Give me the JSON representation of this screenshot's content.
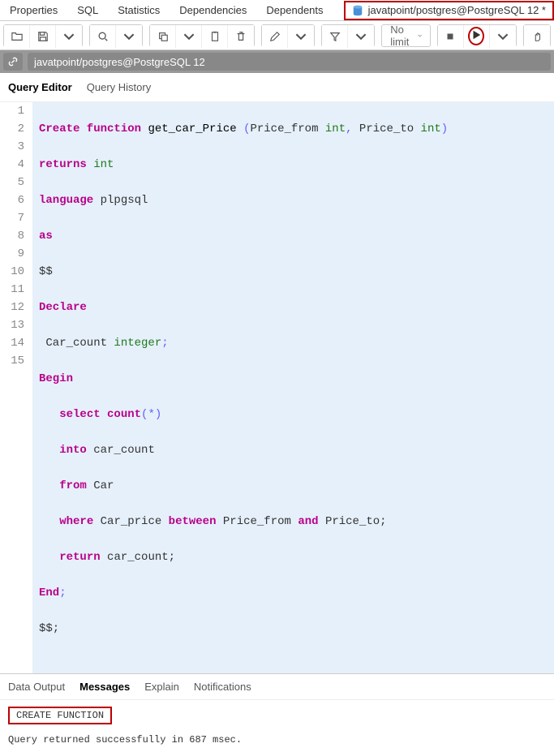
{
  "topTabs": {
    "properties": "Properties",
    "sql": "SQL",
    "statistics": "Statistics",
    "dependencies": "Dependencies",
    "dependents": "Dependents"
  },
  "connTab": "javatpoint/postgres@PostgreSQL 12 *",
  "toolbar": {
    "nolimit": "No limit"
  },
  "connBar": {
    "value": "javatpoint/postgres@PostgreSQL 12"
  },
  "editorTabs": {
    "query": "Query Editor",
    "history": "Query History"
  },
  "code": {
    "l1a": "Create function",
    "l1b": "get_car_Price",
    "l1c": "Price_from",
    "l1d": "int",
    "l1e": "Price_to",
    "l1f": "int",
    "l2a": "returns",
    "l2b": "int",
    "l3a": "language",
    "l3b": "plpgsql",
    "l4a": "as",
    "l5a": "$$",
    "l6a": "Declare",
    "l7a": " Car_count",
    "l7b": "integer",
    "l7c": ";",
    "l8a": "Begin",
    "l9a": "select count",
    "l9b": "(",
    "l9c": "*",
    "l9d": ")",
    "l10a": "into",
    "l10b": "car_count",
    "l11a": "from",
    "l11b": "Car",
    "l12a": "where",
    "l12b": "Car_price",
    "l12c": "between",
    "l12d": "Price_from",
    "l12e": "and",
    "l12f": "Price_to;",
    "l13a": "return",
    "l13b": "car_count;",
    "l14a": "End",
    "l14b": ";",
    "l15a": "$$;"
  },
  "lines": [
    "1",
    "2",
    "3",
    "4",
    "5",
    "6",
    "7",
    "8",
    "9",
    "10",
    "11",
    "12",
    "13",
    "14",
    "15"
  ],
  "outputTabs": {
    "data": "Data Output",
    "messages": "Messages",
    "explain": "Explain",
    "notifications": "Notifications"
  },
  "messages": {
    "result": "CREATE FUNCTION",
    "status": "Query returned successfully in 687 msec."
  }
}
